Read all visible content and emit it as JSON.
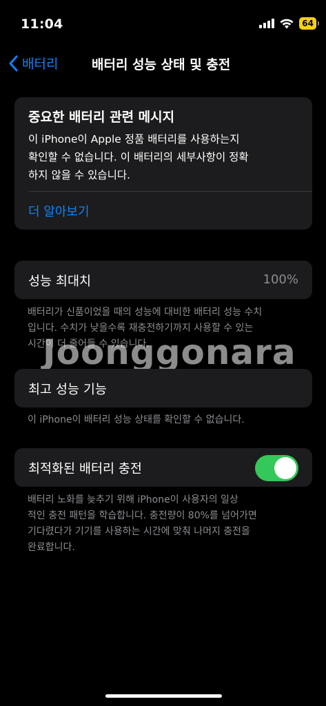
{
  "status_bar": {
    "time": "11:04",
    "battery_level": "64",
    "battery_color": "#f5d10f"
  },
  "nav": {
    "back_label": "배터리",
    "title": "배터리 성능 상태 및 충전"
  },
  "message_card": {
    "title": "중요한 배터리 관련 메시지",
    "body_lines": [
      "이 iPhone이 Apple 정품 배터리를 사용하는지",
      "확인할 수 없습니다. 이 배터리의 세부사항이 정확",
      "하지 않을 수 있습니다."
    ],
    "link": "더 알아보기"
  },
  "max_capacity": {
    "label": "성능 최대치",
    "value": "100%",
    "footnote_lines": [
      "배터리가 신품이었을 때의 성능에 대비한 배터리 성능 수치",
      "입니다. 수치가 낮을수록 재충전하기까지 사용할 수 있는",
      "시간이 더 줄어들 수 있습니다."
    ]
  },
  "peak_performance": {
    "label": "최고 성능 기능",
    "footnote_lines": [
      "이 iPhone이 배터리 성능 상태를 확인할 수 없습니다."
    ]
  },
  "optimized_charging": {
    "label": "최적화된 배터리 충전",
    "enabled": true,
    "toggle_color": "#34c759",
    "footnote_lines": [
      "배터리 노화를 늦추기 위해 iPhone이 사용자의 일상",
      "적인 충전 패턴을 학습합니다. 충전량이 80%를 넘어가면",
      "기다렸다가 기기를 사용하는 시간에 맞춰 나머지 충전을",
      "완료합니다."
    ]
  },
  "watermark": "Joonggonara",
  "accent_color": "#0a84ff"
}
